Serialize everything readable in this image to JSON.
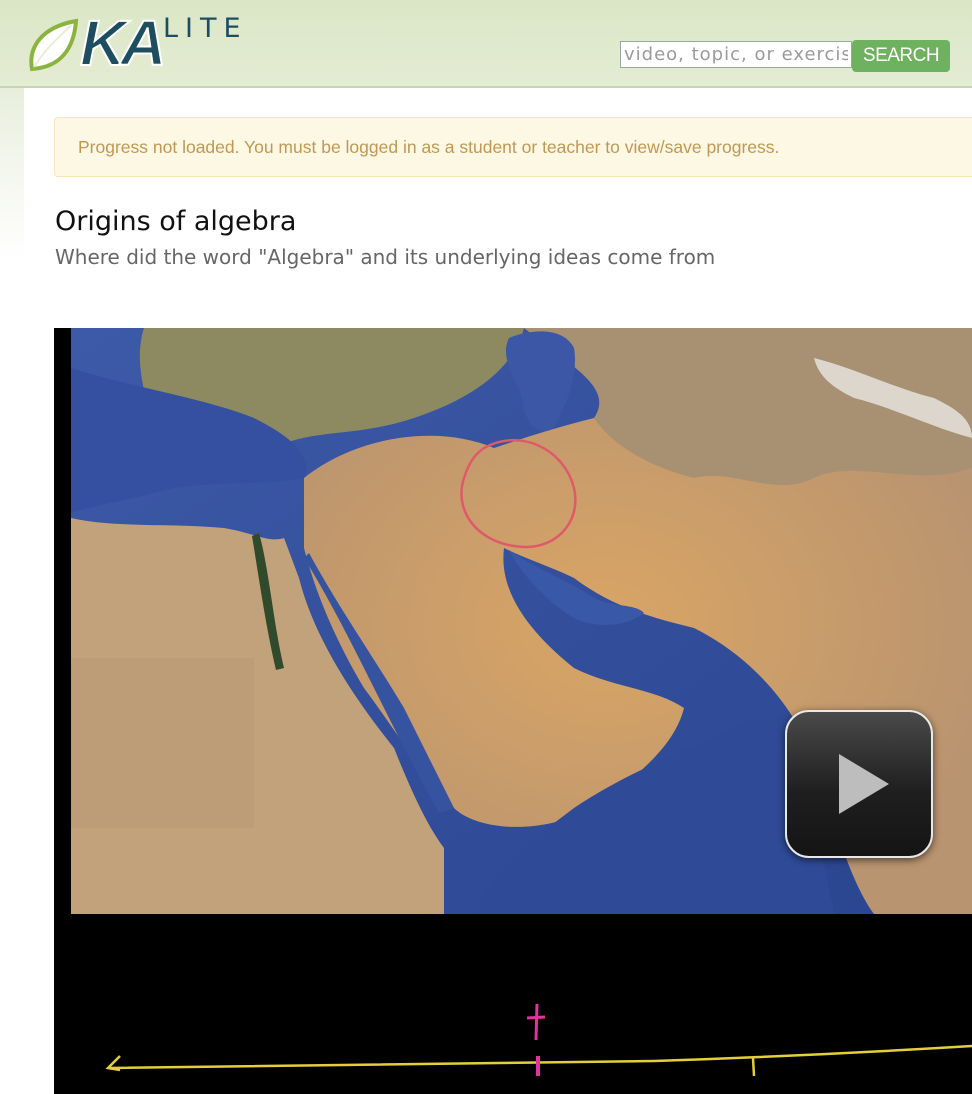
{
  "header": {
    "logo": {
      "mark": "KA",
      "suffix": "LITE",
      "leaf_icon": "leaf-icon"
    },
    "search": {
      "placeholder": "video, topic, or exercise",
      "value": "",
      "button_label": "SEARCH"
    },
    "colors": {
      "header_bg": "#dbe6c6",
      "search_button": "#6eb15f",
      "logo_text": "#1d4e5f"
    }
  },
  "alert": {
    "text": "Progress not loaded. You must be logged in as a student or teacher to view/save progress.",
    "colors": {
      "background": "#fcf8e3",
      "text": "#c09853"
    }
  },
  "main": {
    "title": "Origins of algebra",
    "subtitle": "Where did the word \"Algebra\" and its underlying ideas come from"
  },
  "video": {
    "poster": "satellite map of the Middle East with a red circle over Mesopotamia; blackboard with a yellow timeline below",
    "play_icon": "play-icon"
  }
}
